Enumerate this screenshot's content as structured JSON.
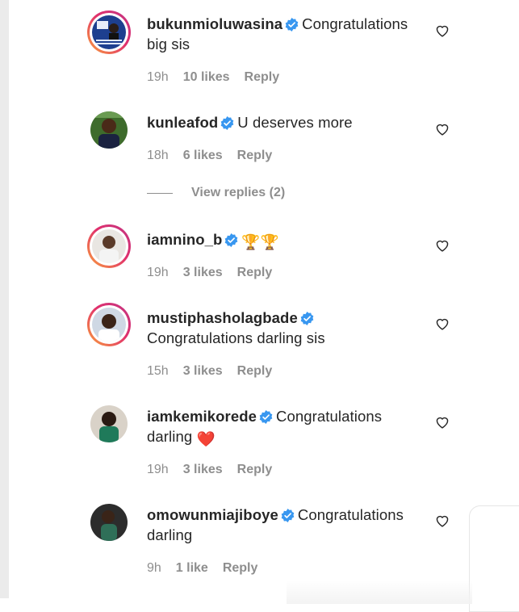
{
  "comments": [
    {
      "username": "bukunmioluwasina",
      "text_line1": "Congratulations",
      "text_line2": "big sis",
      "time": "19h",
      "likes": "10 likes",
      "reply": "Reply",
      "avatar_icon": "profile-photo-poster"
    },
    {
      "username": "kunleafod",
      "text_line1": "U deserves more",
      "time": "18h",
      "likes": "6 likes",
      "reply": "Reply",
      "view_replies": "View replies (2)",
      "avatar_icon": "profile-photo-man"
    },
    {
      "username": "iamnino_b",
      "emoji": "🏆🏆",
      "time": "19h",
      "likes": "3 likes",
      "reply": "Reply",
      "avatar_icon": "profile-photo-boy"
    },
    {
      "username": "mustiphasholagbade",
      "text_line1": "Congratulations darling sis",
      "time": "15h",
      "likes": "3 likes",
      "reply": "Reply",
      "avatar_icon": "profile-photo-smiling-man"
    },
    {
      "username": "iamkemikorede",
      "text_line1": "Congratulations",
      "text_line2": "darling",
      "emoji": "❤️",
      "time": "19h",
      "likes": "3 likes",
      "reply": "Reply",
      "avatar_icon": "profile-photo-woman-green"
    },
    {
      "username": "omowunmiajiboye",
      "text_line1": "Congratulations",
      "text_line2": "darling",
      "time": "9h",
      "likes": "1 like",
      "reply": "Reply",
      "avatar_icon": "profile-photo-woman"
    }
  ],
  "colors": {
    "verified_badge": "#3897f0",
    "meta_text": "#8e8e8e",
    "username_text": "#262626",
    "story_ring_start": "#f9a13b",
    "story_ring_end": "#c13584"
  }
}
